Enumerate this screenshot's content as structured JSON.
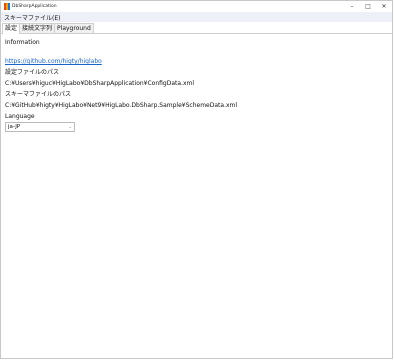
{
  "window": {
    "title": "DbSharpApplication",
    "controls": {
      "minimize": "–",
      "maximize": "□",
      "close": "✕"
    }
  },
  "menu": {
    "items": [
      "スキーマファイル(E)"
    ]
  },
  "tabs": [
    {
      "label": "設定",
      "active": true
    },
    {
      "label": "接続文字列",
      "active": false
    },
    {
      "label": "Playground",
      "active": false
    }
  ],
  "settings": {
    "information_label": "Information",
    "information_link": "https://github.com/higty/higlabo",
    "config_path_label": "設定ファイルのパス",
    "config_path_value": "C:¥Users¥higuc¥HigLabo¥DbSharpApplication¥ConfigData.xml",
    "schema_path_label": "スキーマファイルのパス",
    "schema_path_value": "C:¥GitHub¥higty¥HigLabo¥Net9¥HigLabo.DbSharp.Sample¥SchemeData.xml",
    "language_label": "Language",
    "language_selected": "ja-JP"
  },
  "colors": {
    "menubar_bg": "#eef0f8",
    "link": "#1a63c8",
    "icon_colors": [
      "#e64a19",
      "#ffa000",
      "#1976d2"
    ]
  }
}
